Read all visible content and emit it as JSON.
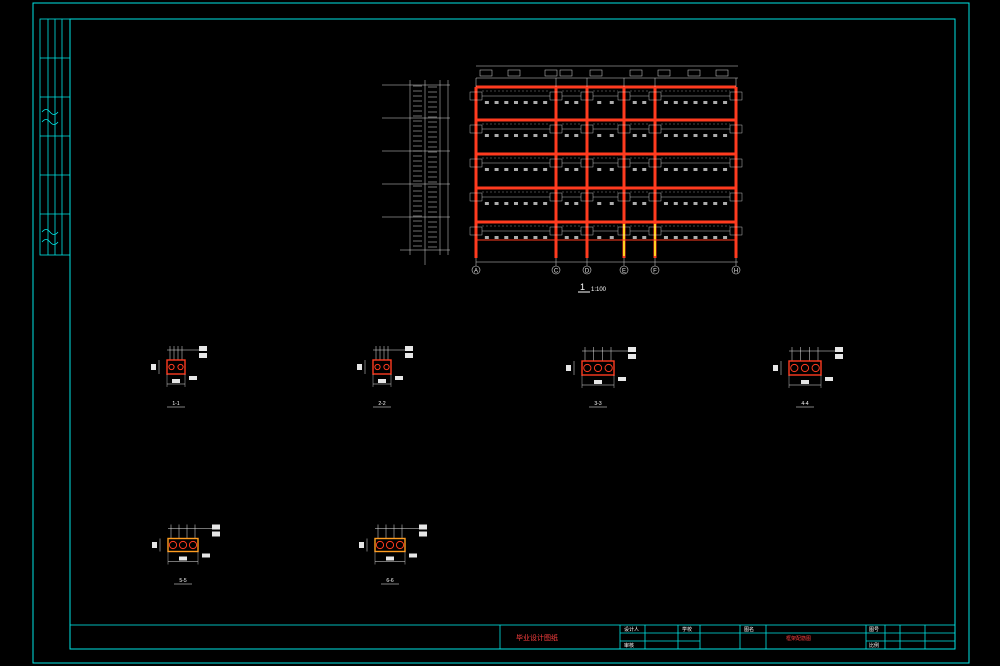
{
  "drawing": {
    "elevation_label": "1",
    "elevation_scale": "1:100",
    "column_axes": [
      "A",
      "C",
      "D",
      "E",
      "F",
      "H"
    ],
    "sections": [
      {
        "id": "s1",
        "label": "1-1"
      },
      {
        "id": "s2",
        "label": "2-2"
      },
      {
        "id": "s3",
        "label": "3-3"
      },
      {
        "id": "s4",
        "label": "4-4"
      },
      {
        "id": "s5",
        "label": "5-5"
      },
      {
        "id": "s6",
        "label": "6-6"
      }
    ]
  },
  "title_block": {
    "project_title": "毕业设计图纸",
    "designer_label": "设计人",
    "checker_label": "审核",
    "school_label": "学校",
    "drawing_name_label": "图名",
    "drawing_name": "框架配筋图",
    "sheet_label": "图号",
    "scale_label": "比例"
  },
  "colors": {
    "border": "#00e5e5",
    "beam": "#ff3b1f",
    "column": "#ff3b1f",
    "rebar": "#e6e6e6",
    "dimension": "#d8d8d8",
    "accent_yellow": "#ffd21f"
  }
}
